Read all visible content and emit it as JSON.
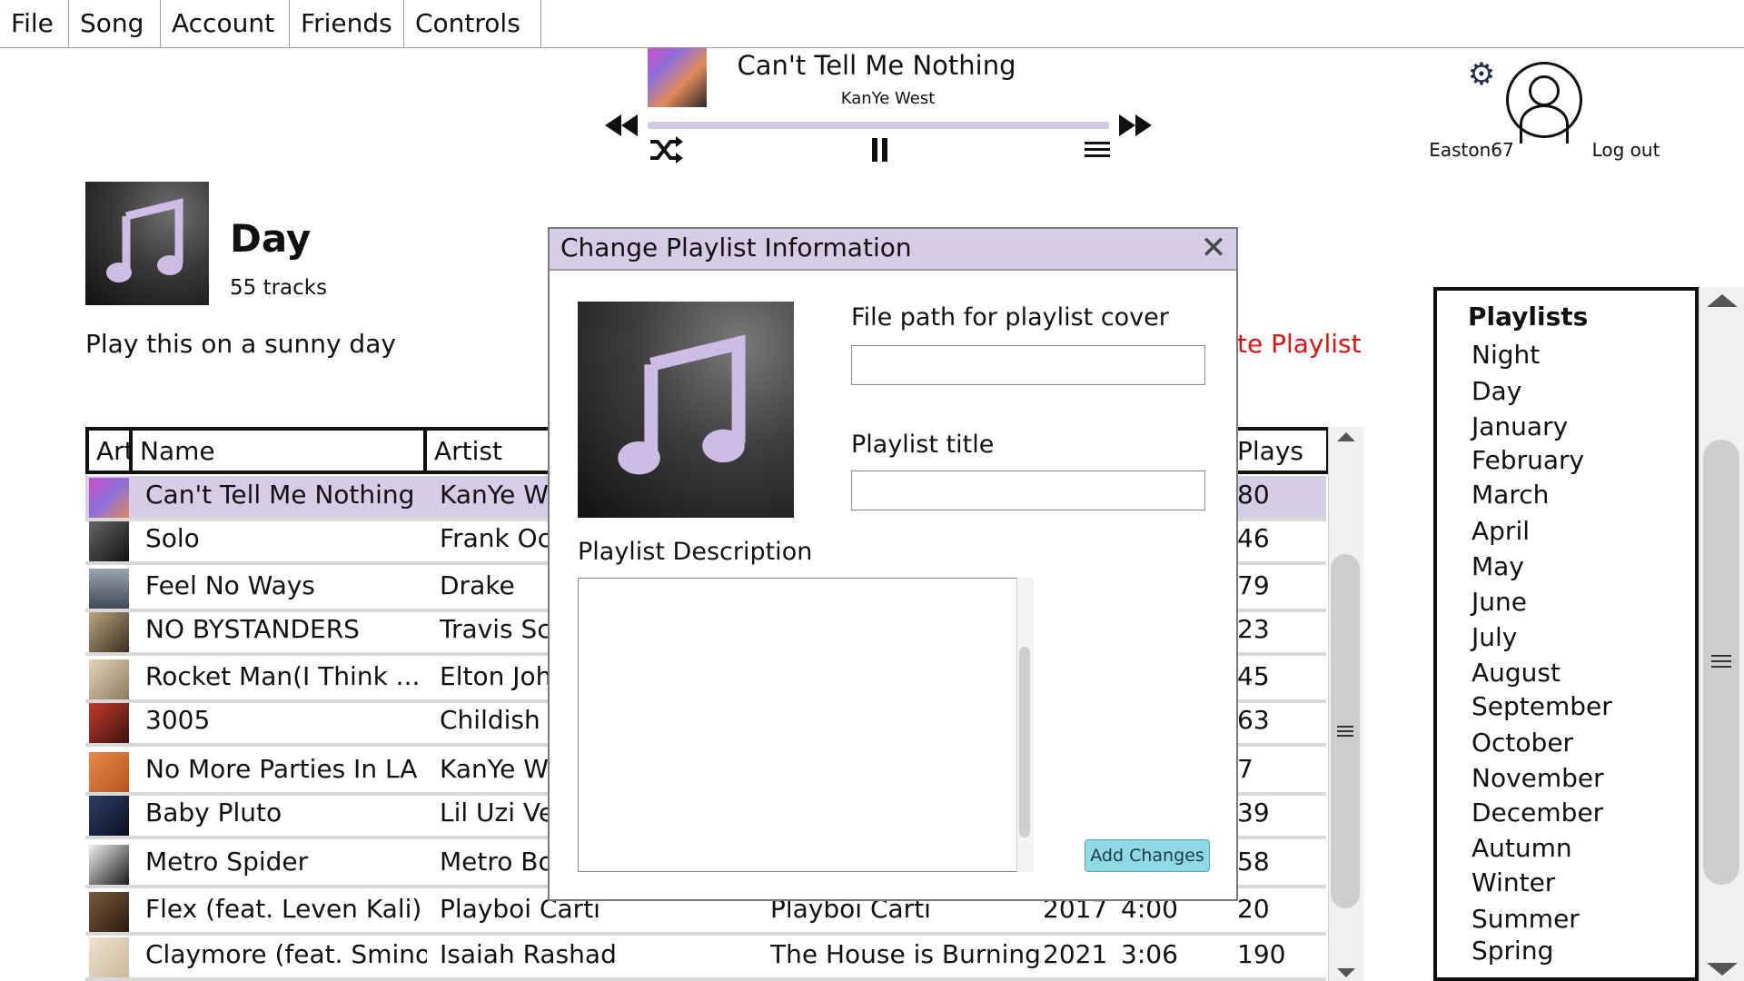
{
  "menu": [
    "File",
    "Song",
    "Account",
    "Friends",
    "Controls"
  ],
  "player": {
    "title": "Can't Tell Me Nothing",
    "artist": "KanYe West",
    "progress": 1.0,
    "accent_color": "#d4c8e8"
  },
  "account": {
    "username": "Easton67",
    "logout": "Log out"
  },
  "playlist": {
    "title": "Day",
    "track_count": "55 tracks",
    "description": "Play this on a sunny day",
    "delete_label_visible": "te Playlist"
  },
  "table": {
    "headers": [
      "Art",
      "Name",
      "Artist",
      "Plays"
    ],
    "rows": [
      {
        "name": "Can't Tell Me Nothing",
        "artist": "KanYe We",
        "album": "",
        "year": "",
        "length": "",
        "plays": "80",
        "selected": true
      },
      {
        "name": "Solo",
        "artist": "Frank Oc",
        "album": "",
        "year": "",
        "length": "",
        "plays": "46"
      },
      {
        "name": "Feel No Ways",
        "artist": "Drake",
        "album": "",
        "year": "",
        "length": "",
        "plays": "79"
      },
      {
        "name": "NO BYSTANDERS",
        "artist": "Travis Sc",
        "album": "",
        "year": "",
        "length": "",
        "plays": "23"
      },
      {
        "name": "Rocket Man(I Think ...",
        "artist": "Elton Joh",
        "album": "",
        "year": "",
        "length": "",
        "plays": "45"
      },
      {
        "name": "3005",
        "artist": "Childish",
        "album": "",
        "year": "",
        "length": "",
        "plays": "63"
      },
      {
        "name": "No More Parties In LA",
        "artist": "KanYe We",
        "album": "",
        "year": "",
        "length": "",
        "plays": "7"
      },
      {
        "name": "Baby Pluto",
        "artist": "Lil Uzi Ve",
        "album": "",
        "year": "",
        "length": "",
        "plays": "39"
      },
      {
        "name": "Metro Spider",
        "artist": "Metro Bo",
        "album": "",
        "year": "",
        "length": "",
        "plays": "58"
      },
      {
        "name": "Flex (feat. Leven Kali)",
        "artist": "Playboi Carti",
        "album": "Playboi Carti",
        "year": "2017",
        "length": "4:00",
        "plays": "20"
      },
      {
        "name": "Claymore (feat. Smino)",
        "artist": "Isaiah Rashad",
        "album": "The House is Burning",
        "year": "2021",
        "length": "3:06",
        "plays": "190"
      }
    ]
  },
  "dialog": {
    "title": "Change Playlist Information",
    "file_path_label": "File path for playlist cover",
    "file_path_value": "",
    "title_label": "Playlist title",
    "title_value": "",
    "description_label": "Playlist Description",
    "description_value": "",
    "add_button": "Add Changes",
    "titlebar_color": "#d5cce6",
    "button_color": "#8fd9e4"
  },
  "sidebar": {
    "heading": "Playlists",
    "items": [
      "Night",
      "Day",
      "January",
      "February",
      "March",
      "April",
      "May",
      "June",
      "July",
      "August",
      "September",
      "October",
      "November",
      "December",
      "Autumn",
      "Winter",
      "Summer",
      "Spring"
    ]
  },
  "icons": {
    "prev": "previous-icon",
    "next": "next-icon",
    "shuffle": "shuffle-icon",
    "pause": "pause-icon",
    "queue": "queue-icon",
    "settings": "gear-icon",
    "avatar": "user-avatar-icon",
    "close": "close-icon"
  }
}
